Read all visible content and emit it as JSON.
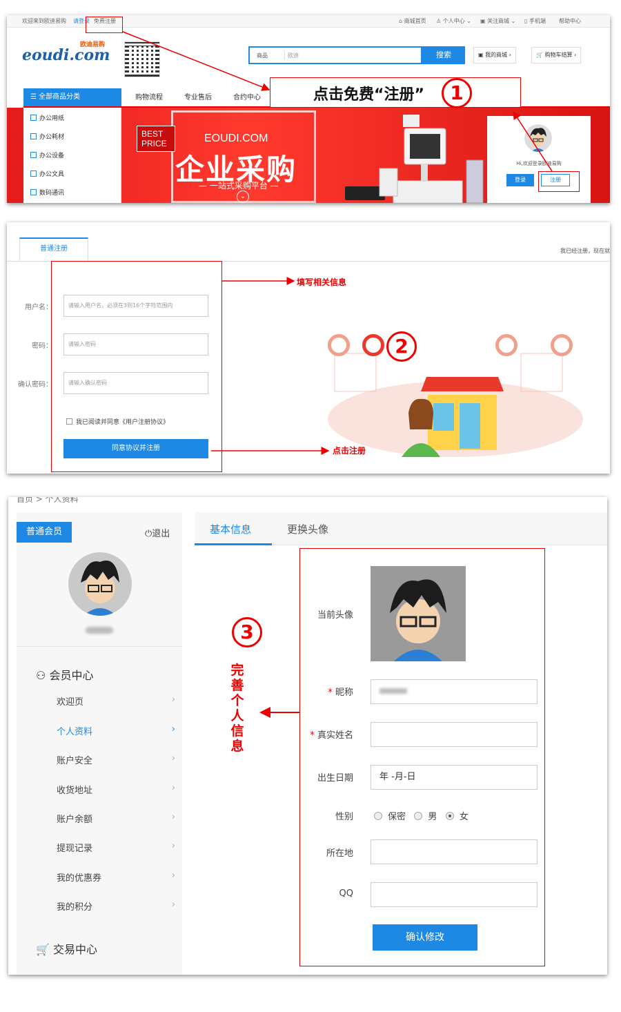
{
  "step1": {
    "topbar": {
      "welcome": "欢迎来到欧迪易购",
      "login": "请登录",
      "register": "免费注册",
      "links": [
        "商城首页",
        "个人中心",
        "关注商城",
        "手机端",
        "帮助中心"
      ]
    },
    "logo_text": "eoudi.com",
    "logo_sub": "欧迪易购",
    "search": {
      "category": "商品",
      "placeholder": "欧迪",
      "button": "搜索"
    },
    "top_buttons": [
      "我的商城",
      "购物车结算"
    ],
    "category_title": "全部商品分类",
    "nav": [
      "购物流程",
      "专业售后",
      "合约中心"
    ],
    "categories": [
      "办公用纸",
      "办公耗材",
      "办公设备",
      "办公文具",
      "数码通讯"
    ],
    "banner": {
      "best": "BEST",
      "price": "PRICE",
      "site": "EOUDI.COM",
      "headline": "企业采购",
      "tagline": "— 一站式采购平台 —"
    },
    "login_box": {
      "hi": "Hi,欢迎登录欧迪易购",
      "login": "登录",
      "register": "注册"
    },
    "callout": "点击免费“注册”",
    "step_no": "1"
  },
  "step2": {
    "tab": "普通注册",
    "right_text": "我已经注册，现在就",
    "fields": [
      {
        "label": "用户名：",
        "placeholder": "请输入用户名，必须在3到16个字符范围内"
      },
      {
        "label": "密码：",
        "placeholder": "请输入密码"
      },
      {
        "label": "确认密码：",
        "placeholder": "请输入确认密码"
      }
    ],
    "agree": "我已阅读并同意《用户注册协议》",
    "button": "同意协议并注册",
    "note_fill": "填写相关信息",
    "note_click": "点击注册",
    "step_no": "2"
  },
  "step3": {
    "breadcrumb": "首页 > 个人资料",
    "badge": "普通会员",
    "logout": "退出",
    "member_center": "会员中心",
    "menu": [
      "欢迎页",
      "个人资料",
      "账户安全",
      "收货地址",
      "账户余额",
      "提现记录",
      "我的优惠券",
      "我的积分"
    ],
    "trade_center": "交易中心",
    "tabs": [
      "基本信息",
      "更换头像"
    ],
    "labels": {
      "avatar": "当前头像",
      "nickname": "昵称",
      "realname": "真实姓名",
      "birthday": "出生日期",
      "gender": "性别",
      "location": "所在地",
      "qq": "QQ"
    },
    "birthday_value": "年 -月-日",
    "gender_options": [
      "保密",
      "男",
      "女"
    ],
    "gender_selected": "女",
    "required_mark": "*",
    "submit": "确认修改",
    "note": "完善个人信息",
    "step_no": "3"
  },
  "colors": {
    "accent": "#1e88e5",
    "annotation": "#e00000",
    "banner": "#e31b1b"
  }
}
